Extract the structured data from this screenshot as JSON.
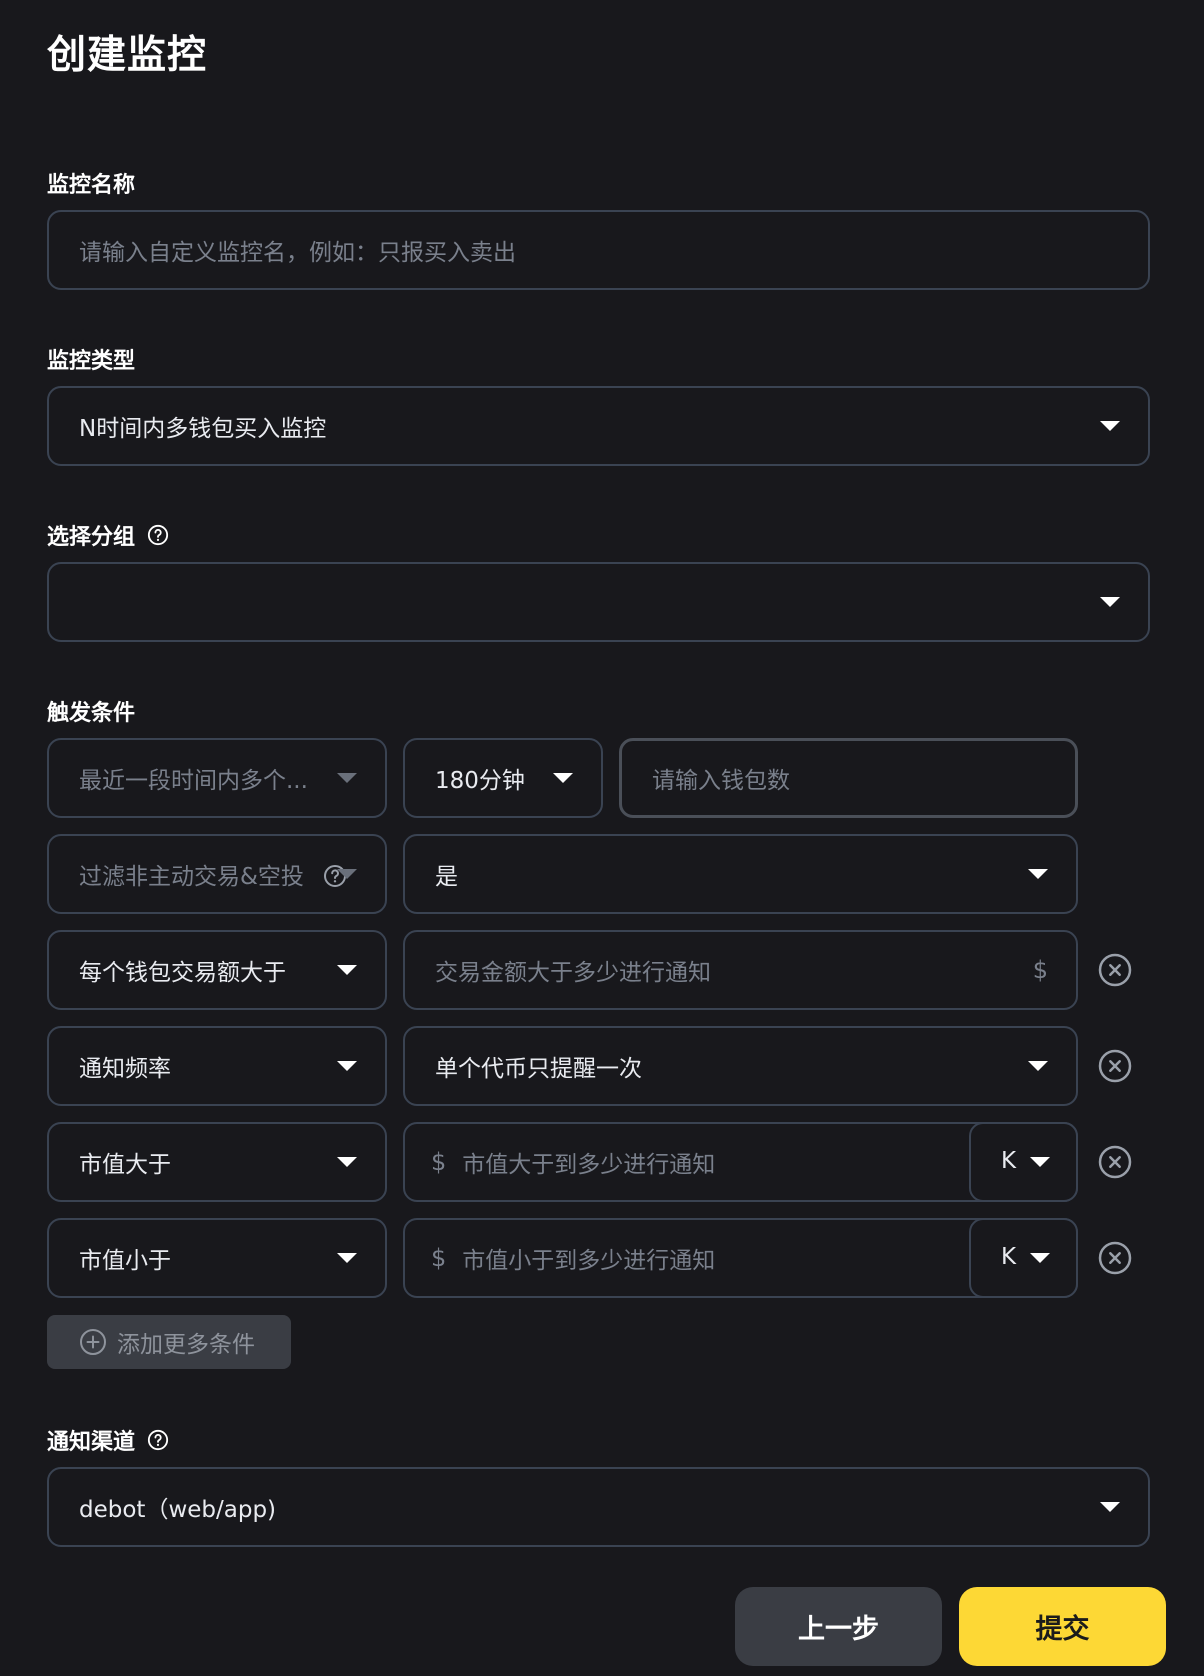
{
  "page_title": "创建监控",
  "name_section": {
    "label": "监控名称",
    "placeholder": "请输入自定义监控名，例如：只报买入卖出"
  },
  "type_section": {
    "label": "监控类型",
    "value": "N时间内多钱包买入监控"
  },
  "group_section": {
    "label": "选择分组",
    "value": ""
  },
  "trigger_section": {
    "label": "触发条件",
    "row1": {
      "type": "最近一段时间内多个...",
      "time": "180分钟",
      "wallet_placeholder": "请输入钱包数"
    },
    "row2": {
      "type": "过滤非主动交易&空投",
      "value": "是"
    },
    "row3": {
      "type": "每个钱包交易额大于",
      "amount_placeholder": "交易金额大于多少进行通知",
      "currency": "$"
    },
    "row4": {
      "type": "通知频率",
      "value": "单个代币只提醒一次"
    },
    "row5": {
      "type": "市值大于",
      "currency": "$",
      "placeholder": "市值大于到多少进行通知",
      "unit": "K"
    },
    "row6": {
      "type": "市值小于",
      "currency": "$",
      "placeholder": "市值小于到多少进行通知",
      "unit": "K"
    },
    "add_button": "添加更多条件"
  },
  "channel_section": {
    "label": "通知渠道",
    "value": "debot（web/app)"
  },
  "buttons": {
    "prev": "上一步",
    "submit": "提交"
  },
  "colors": {
    "background": "#18181c",
    "border": "#3a4352",
    "accent": "#fdd835",
    "secondary_button": "#3a3d44"
  }
}
